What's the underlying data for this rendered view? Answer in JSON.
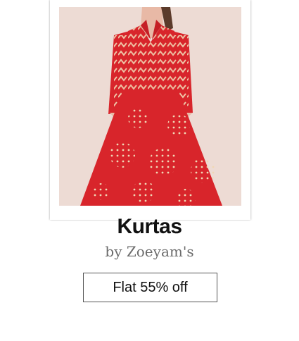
{
  "product": {
    "category_title": "Kurtas",
    "brand_line": "by Zoeyam's",
    "offer_label": "Flat 55% off",
    "image_icon": "red-kurta-photo"
  },
  "colors": {
    "kurta_red": "#d8252b",
    "print_gold": "#f0d7b4",
    "background": "#ffffff",
    "photo_bg": "#ecd7d0"
  }
}
